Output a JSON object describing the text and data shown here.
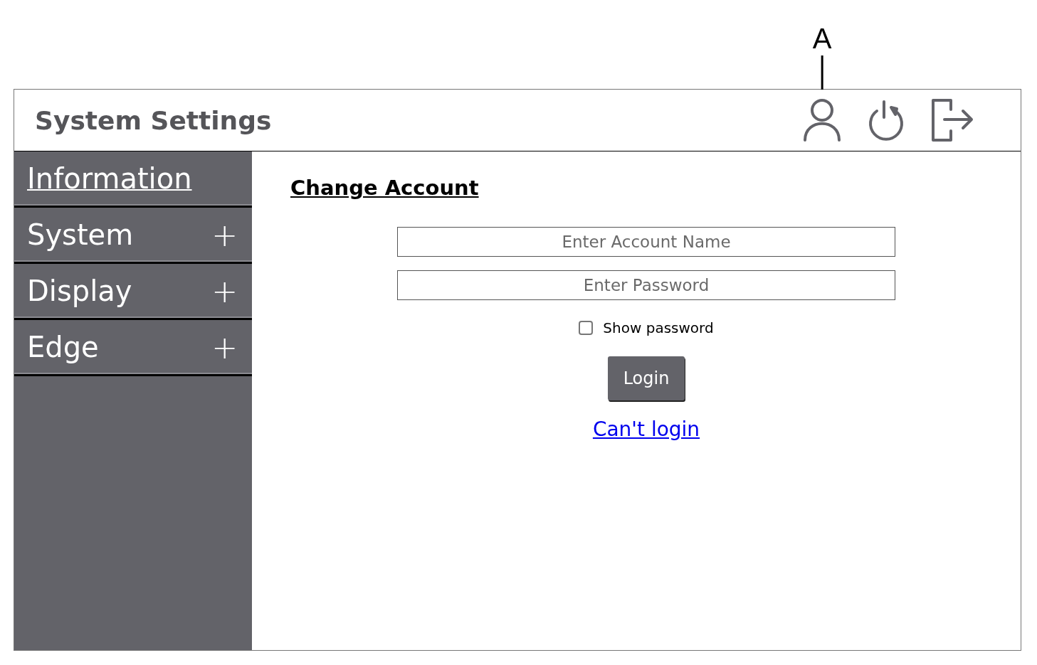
{
  "callout": {
    "label": "A"
  },
  "header": {
    "title": "System Settings"
  },
  "sidebar": {
    "items": [
      {
        "label": "Information",
        "kind": "link"
      },
      {
        "label": "System",
        "kind": "expandable",
        "symbol": "+"
      },
      {
        "label": "Display",
        "kind": "expandable",
        "symbol": "+"
      },
      {
        "label": "Edge",
        "kind": "expandable",
        "symbol": "+"
      }
    ]
  },
  "form": {
    "heading": "Change Account",
    "account_field": {
      "placeholder": "Enter Account Name"
    },
    "password_field": {
      "placeholder": "Enter Password"
    },
    "show_password": {
      "label": "Show password",
      "checked": false
    },
    "login_button": "Login",
    "help_link": "Can't login"
  }
}
